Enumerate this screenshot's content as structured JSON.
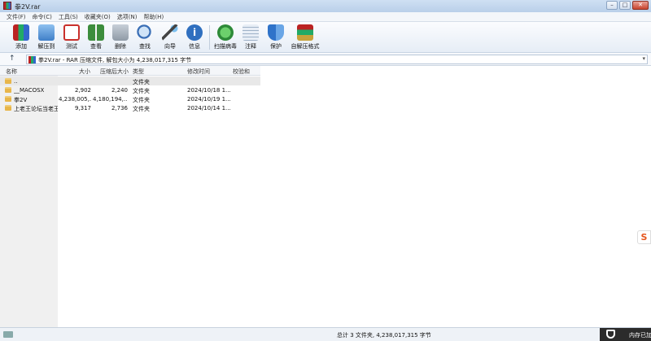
{
  "window": {
    "title": "拳2V.rar"
  },
  "menu": [
    "文件(F)",
    "命令(C)",
    "工具(S)",
    "收藏夹(O)",
    "选项(N)",
    "帮助(H)"
  ],
  "toolbar": [
    {
      "name": "add",
      "label": "添加",
      "color": "#c9302c"
    },
    {
      "name": "extract-to",
      "label": "解压到",
      "color": "#4a8fd8"
    },
    {
      "name": "test",
      "label": "测试",
      "color": "#d9534f"
    },
    {
      "name": "view",
      "label": "查看",
      "color": "#3c8d3c"
    },
    {
      "name": "delete",
      "label": "删除",
      "color": "#8f9aa6"
    },
    {
      "name": "find",
      "label": "查找",
      "color": "#3b6fb6"
    },
    {
      "name": "wizard",
      "label": "向导",
      "color": "#5aa0d8"
    },
    {
      "name": "info",
      "label": "信息",
      "color": "#2f6fbf"
    },
    {
      "name": "virus-scan",
      "label": "扫描病毒",
      "color": "#3aa34a"
    },
    {
      "name": "comment",
      "label": "注释",
      "color": "#7a8fa8"
    },
    {
      "name": "protect",
      "label": "保护",
      "color": "#2f73c9"
    },
    {
      "name": "sfx",
      "label": "自解压格式",
      "color": "#c7a23a"
    }
  ],
  "address": {
    "path": "拳2V.rar - RAR 压缩文件, 解包大小为 4,238,017,315 字节"
  },
  "columns": [
    "名称",
    "大小",
    "压缩后大小",
    "类型",
    "修改时间",
    "校验和"
  ],
  "rows": [
    {
      "name": "..",
      "size": "",
      "packed": "",
      "type": "文件夹",
      "modified": "",
      "crc": ""
    },
    {
      "name": "__MACOSX",
      "size": "2,902",
      "packed": "2,240",
      "type": "文件夹",
      "modified": "2024/10/18 1...",
      "crc": ""
    },
    {
      "name": "拳2V",
      "size": "4,238,005,...",
      "packed": "4,180,194,...",
      "type": "文件夹",
      "modified": "2024/10/19 1...",
      "crc": ""
    },
    {
      "name": "上老王论坛当老王",
      "size": "9,317",
      "packed": "2,736",
      "type": "文件夹",
      "modified": "2024/10/14 1...",
      "crc": ""
    }
  ],
  "status": {
    "summary": "总计 3 文件夹, 4,238,017,315 字节"
  },
  "tray": {
    "text": "内存已加"
  }
}
